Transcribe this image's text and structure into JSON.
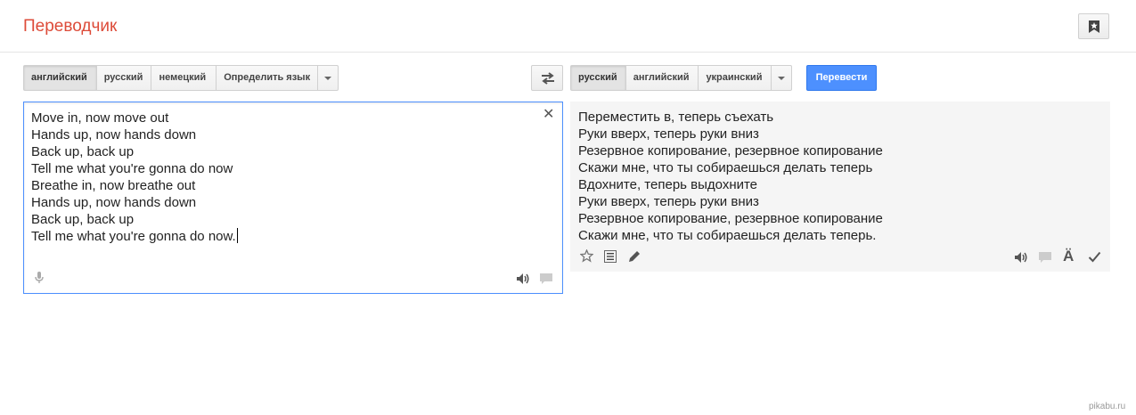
{
  "header": {
    "title": "Переводчик"
  },
  "source_langs": {
    "items": [
      "английский",
      "русский",
      "немецкий",
      "Определить язык"
    ],
    "active": 0
  },
  "target_langs": {
    "items": [
      "русский",
      "английский",
      "украинский"
    ],
    "active": 0
  },
  "translate_button": {
    "label": "Перевести"
  },
  "source": {
    "lines": [
      "Move in, now move out",
      "Hands up, now hands down",
      "Back up, back up",
      "Tell me what you're gonna do now",
      "Breathe in, now breathe out",
      "Hands up, now hands down",
      "Back up, back up",
      "Tell me what you're gonna do now."
    ]
  },
  "result": {
    "lines": [
      "Переместить в, теперь съехать",
      "Руки вверх, теперь руки вниз",
      "Резервное копирование, резервное копирование",
      "Скажи мне, что ты собираешься делать теперь",
      "Вдохните, теперь выдохните",
      "Руки вверх, теперь руки вниз",
      "Резервное копирование, резервное копирование",
      "Скажи мне, что ты собираешься делать теперь."
    ]
  },
  "icons": {
    "accent_char": "Ä",
    "accent_color": "#4d90fe",
    "title_color": "#dd4b39"
  },
  "watermark": "pikabu.ru"
}
